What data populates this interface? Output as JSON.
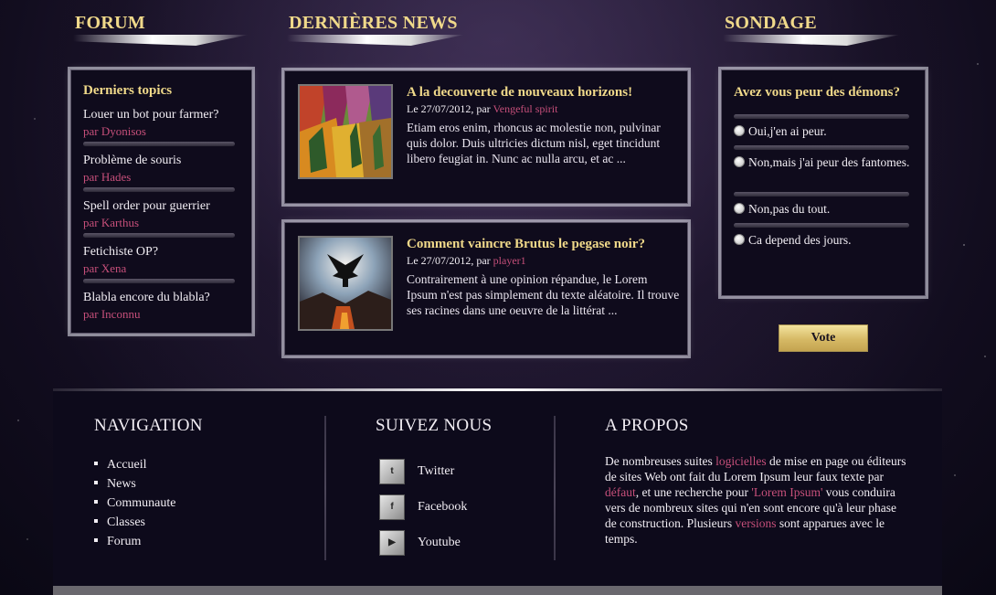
{
  "forum": {
    "title": "FORUM",
    "heading": "Derniers topics",
    "topics": [
      {
        "title": "Louer un bot pour farmer?",
        "by": "par Dyonisos"
      },
      {
        "title": "Problème de souris",
        "by": "par Hades"
      },
      {
        "title": "Spell order pour guerrier",
        "by": "par Karthus"
      },
      {
        "title": "Fetichiste OP?",
        "by": "par Xena"
      },
      {
        "title": "Blabla encore du blabla?",
        "by": "par Inconnu"
      }
    ]
  },
  "news": {
    "title": "DERNIÈRES NEWS",
    "items": [
      {
        "title": "A la decouverte de nouveaux horizons!",
        "date": "Le 27/07/2012, par ",
        "author": "Vengeful spirit",
        "text": "Etiam eros enim, rhoncus ac molestie non, pulvinar quis dolor. Duis ultricies dictum nisl, eget tincidunt libero feugiat in. Nunc ac nulla arcu, et ac ..."
      },
      {
        "title": "Comment vaincre Brutus le pegase noir?",
        "date": "Le 27/07/2012, par ",
        "author": "player1",
        "text": "Contrairement à une opinion répandue, le Lorem Ipsum n'est pas simplement du texte aléatoire. Il trouve ses racines dans une oeuvre de la littérat ..."
      }
    ]
  },
  "poll": {
    "title": "SONDAGE",
    "question": "Avez vous peur des démons?",
    "options": [
      "Oui,j'en ai peur.",
      "Non,mais j'ai peur des fantomes.",
      "Non,pas du tout.",
      "Ca depend des jours."
    ],
    "vote_label": "Vote"
  },
  "footer": {
    "navigation": {
      "title": "NAVIGATION",
      "items": [
        "Accueil",
        "News",
        "Communaute",
        "Classes",
        "Forum"
      ]
    },
    "social": {
      "title": "SUIVEZ NOUS",
      "items": [
        {
          "label": "Twitter",
          "icon": "twitter-icon"
        },
        {
          "label": "Facebook",
          "icon": "facebook-icon"
        },
        {
          "label": "Youtube",
          "icon": "youtube-icon"
        }
      ]
    },
    "about": {
      "title": "A PROPOS",
      "p1": "De nombreuses suites ",
      "h1": "logicielles",
      "p2": " de mise en page ou éditeurs de sites Web ont fait du Lorem Ipsum leur faux texte par ",
      "h2": "défaut",
      "p3": ", et une recherche pour ",
      "h3": "'Lorem Ipsum'",
      "p4": " vous conduira vers de nombreux sites qui n'en sont encore qu'à leur phase de construction. Plusieurs ",
      "h4": "versions",
      "p5": " sont apparues avec le temps."
    }
  },
  "colors": {
    "accent_gold": "#f0d98a",
    "link_pink": "#c64f7a",
    "panel_bg": "#0f0b1c"
  }
}
